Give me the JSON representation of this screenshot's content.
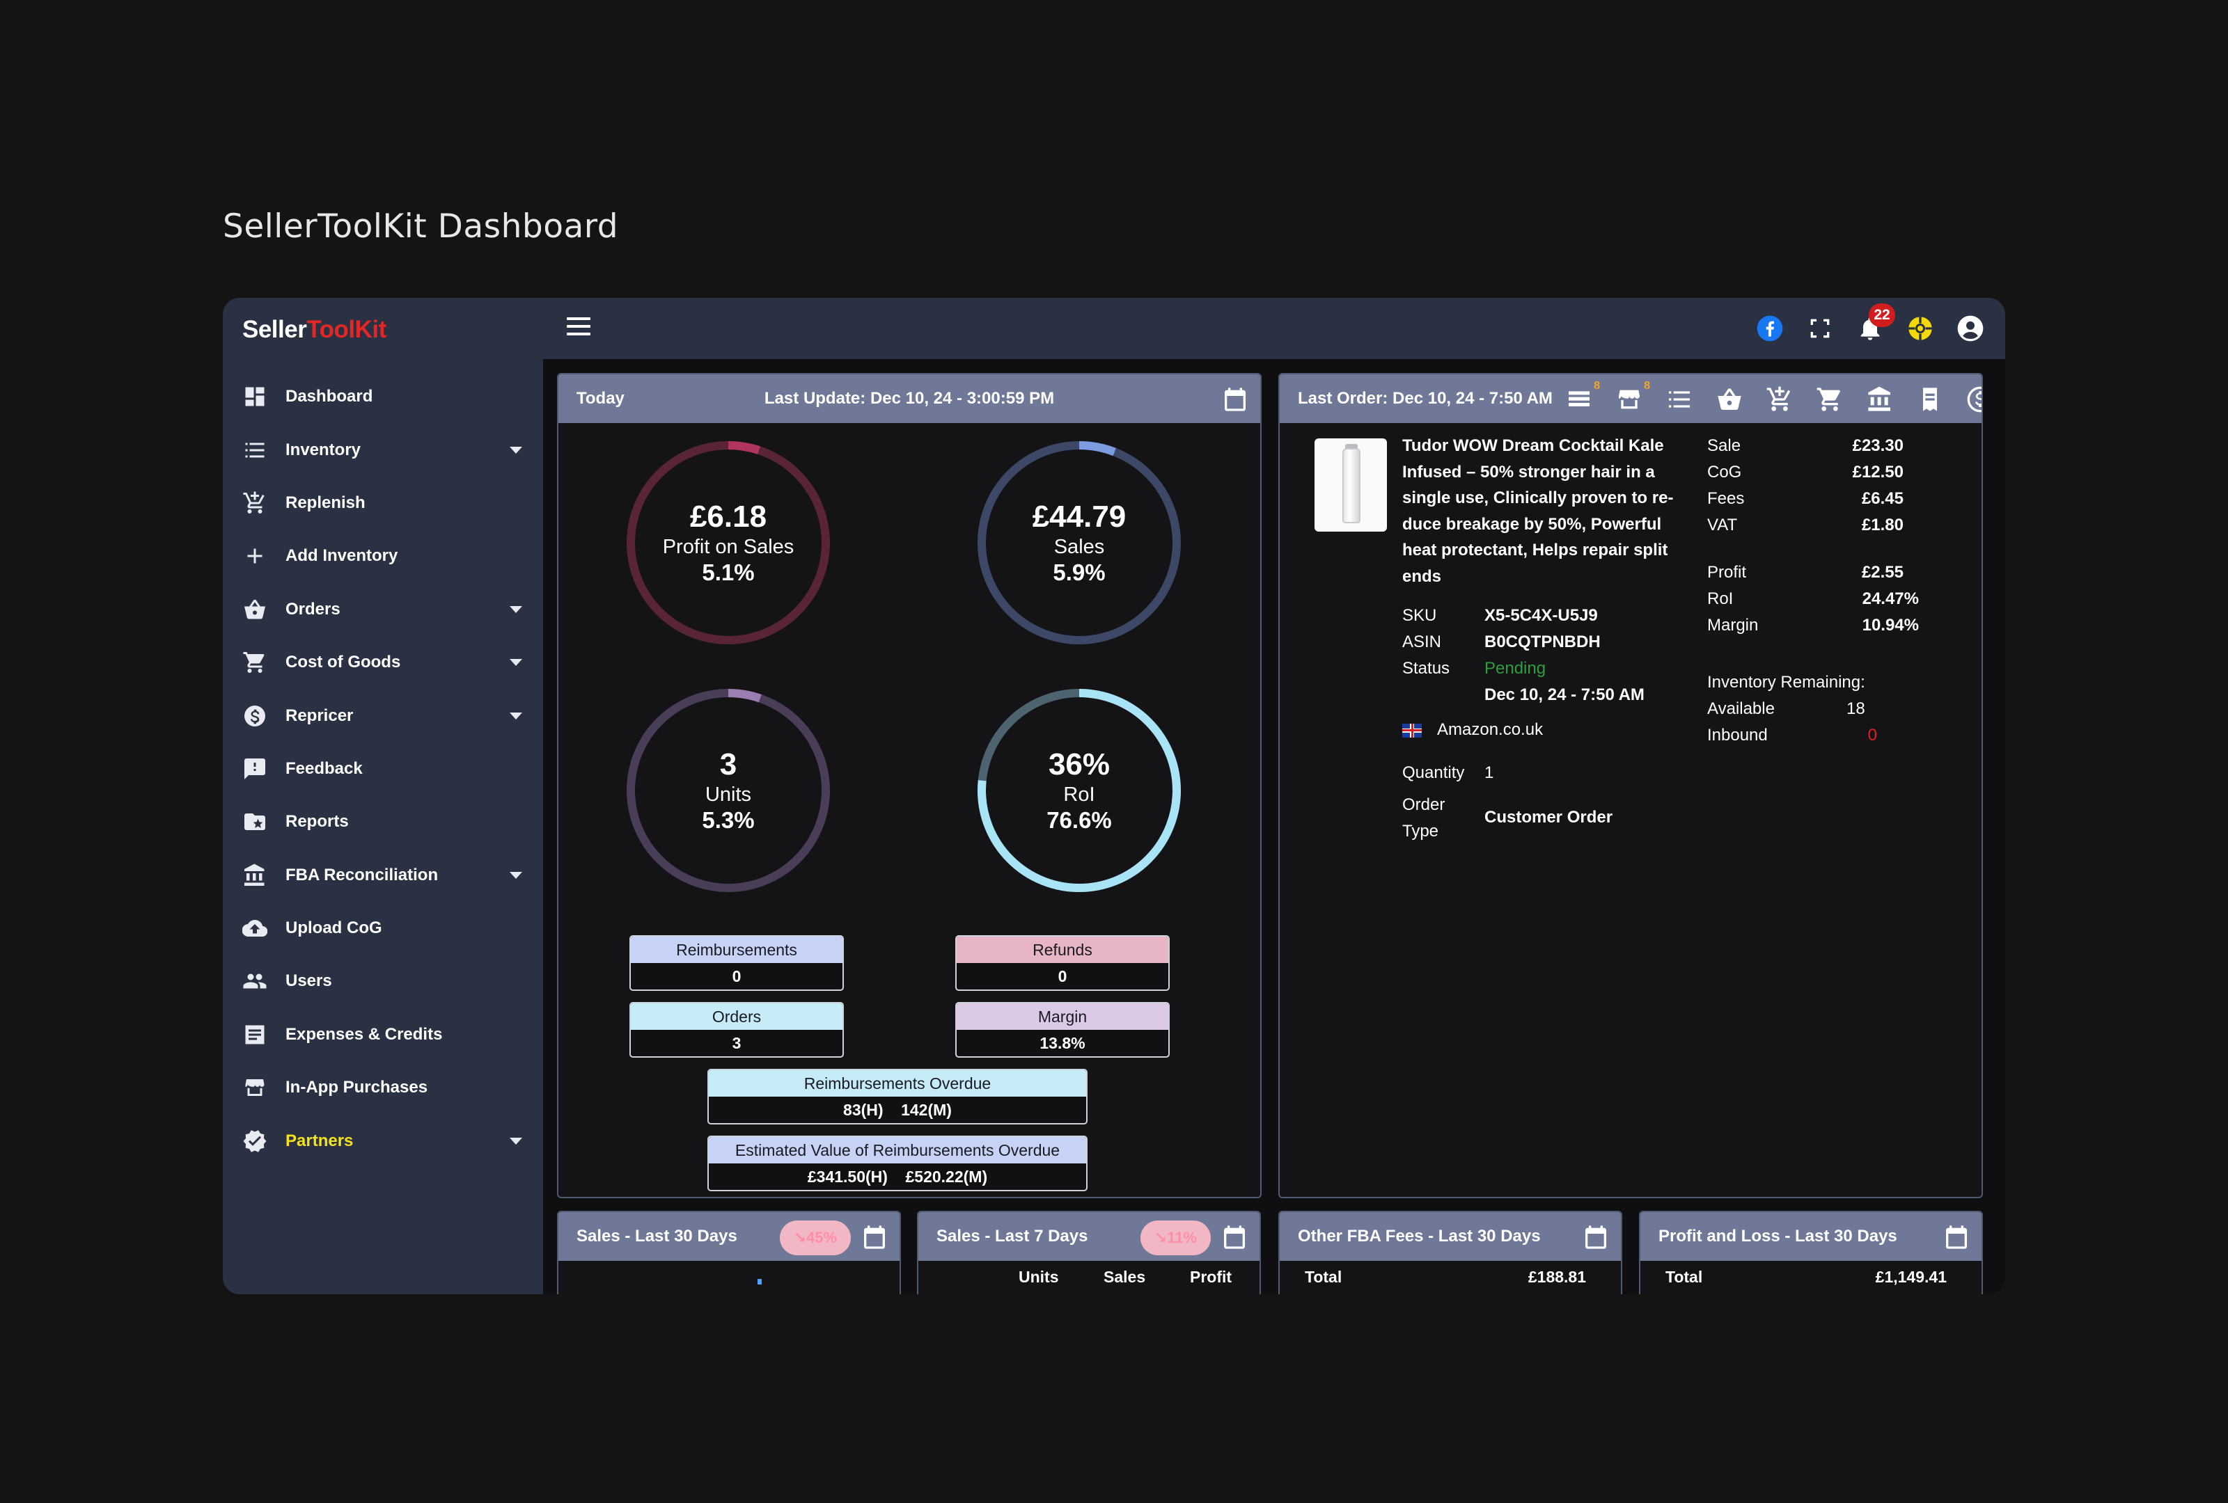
{
  "page_title": "SellerToolKit Dashboard",
  "brand": {
    "part1": "Seller",
    "part2": "ToolKit"
  },
  "sidebar": {
    "items": [
      {
        "label": "Dashboard",
        "icon": "dashboard-icon",
        "caret": false
      },
      {
        "label": "Inventory",
        "icon": "list-icon",
        "caret": true
      },
      {
        "label": "Replenish",
        "icon": "cart-add-icon",
        "caret": false
      },
      {
        "label": "Add Inventory",
        "icon": "plus-icon",
        "caret": false
      },
      {
        "label": "Orders",
        "icon": "basket-icon",
        "caret": true
      },
      {
        "label": "Cost of Goods",
        "icon": "shopping-cart-icon",
        "caret": true
      },
      {
        "label": "Repricer",
        "icon": "dollar-circle-icon",
        "caret": true
      },
      {
        "label": "Feedback",
        "icon": "feedback-icon",
        "caret": false
      },
      {
        "label": "Reports",
        "icon": "folder-star-icon",
        "caret": false
      },
      {
        "label": "FBA Reconciliation",
        "icon": "bank-icon",
        "caret": true
      },
      {
        "label": "Upload CoG",
        "icon": "cloud-upload-icon",
        "caret": false
      },
      {
        "label": "Users",
        "icon": "users-icon",
        "caret": false
      },
      {
        "label": "Expenses & Credits",
        "icon": "receipt-icon",
        "caret": false
      },
      {
        "label": "In-App Purchases",
        "icon": "store-icon",
        "caret": false
      },
      {
        "label": "Partners",
        "icon": "verified-badge-icon",
        "caret": true,
        "highlight": true
      }
    ]
  },
  "topbar": {
    "notification_count": "22",
    "icons": [
      "facebook-icon",
      "fullscreen-icon",
      "bell-icon",
      "support-icon",
      "account-icon"
    ]
  },
  "today": {
    "title": "Today",
    "last_update": "Last Update: Dec 10, 24 - 3:00:59 PM",
    "rings": {
      "profit": {
        "value": "£6.18",
        "label": "Profit on Sales",
        "pct": "5.1%",
        "fill": 0.051,
        "color": "#b0355f",
        "track": "#5a2438"
      },
      "sales": {
        "value": "£44.79",
        "label": "Sales",
        "pct": "5.9%",
        "fill": 0.059,
        "color": "#7d9be0",
        "track": "#3d4866"
      },
      "units": {
        "value": "3",
        "label": "Units",
        "pct": "5.3%",
        "fill": 0.053,
        "color": "#9b7fb2",
        "track": "#4a3d57"
      },
      "roi": {
        "value": "36%",
        "label": "RoI",
        "pct": "76.6%",
        "fill": 0.766,
        "color": "#a8e4f5",
        "track": "#4d6470"
      }
    },
    "stats": {
      "reimbursements": {
        "label": "Reimbursements",
        "value": "0"
      },
      "refunds": {
        "label": "Refunds",
        "value": "0"
      },
      "orders": {
        "label": "Orders",
        "value": "3"
      },
      "margin": {
        "label": "Margin",
        "value": "13.8%"
      },
      "reimb_overdue": {
        "label": "Reimbursements Overdue",
        "value": "83(H)    142(M)"
      },
      "est_value": {
        "label": "Estimated Value of Reimbursements Overdue",
        "value": "£341.50(H)    £520.22(M)"
      }
    }
  },
  "last_order": {
    "title": "Last Order: Dec 10, 24 - 7:50 AM",
    "header_icons": [
      "order-list-icon",
      "store-icon",
      "list-icon",
      "basket-icon",
      "cart-add-icon",
      "shopping-cart-icon",
      "bank-icon",
      "receipt-icon",
      "dollar-icon"
    ],
    "badge1": "8",
    "badge2": "8",
    "product_title": "Tudor WOW Dream Cocktail Kale Infused – 50% stronger hair in a single use, Clinically proven to re-duce breakage by 50%, Powerful heat protectant, Helps repair split ends",
    "sku_label": "SKU",
    "sku": "X5-5C4X-U5J9",
    "asin_label": "ASIN",
    "asin": "B0CQTPNBDH",
    "status_label": "Status",
    "status": "Pending",
    "date": "Dec 10, 24 - 7:50 AM",
    "marketplace": "Amazon.co.uk",
    "quantity_label": "Quantity",
    "quantity": "1",
    "order_type_label_1": "Order",
    "order_type_label_2": "Type",
    "order_type": "Customer Order",
    "financials": {
      "sale_label": "Sale",
      "sale": "£23.30",
      "cog_label": "CoG",
      "cog": "£12.50",
      "fees_label": "Fees",
      "fees": "£6.45",
      "vat_label": "VAT",
      "vat": "£1.80",
      "profit_label": "Profit",
      "profit": "£2.55",
      "roi_label": "RoI",
      "roi": "24.47%",
      "margin_label": "Margin",
      "margin": "10.94%"
    },
    "inventory": {
      "title": "Inventory Remaining:",
      "available_label": "Available",
      "available": "18",
      "inbound_label": "Inbound",
      "inbound": "0"
    }
  },
  "bottom": {
    "sales30": {
      "title": "Sales - Last 30 Days",
      "trend": "↘45%"
    },
    "sales7": {
      "title": "Sales - Last 7 Days",
      "trend": "↘11%",
      "col1": "Units",
      "col2": "Sales",
      "col3": "Profit"
    },
    "fees30": {
      "title": "Other FBA Fees - Last 30 Days",
      "row_label": "Total",
      "row_value": "£188.81"
    },
    "pl30": {
      "title": "Profit and Loss - Last 30 Days",
      "row_label": "Total",
      "row_value": "£1,149.41"
    }
  }
}
